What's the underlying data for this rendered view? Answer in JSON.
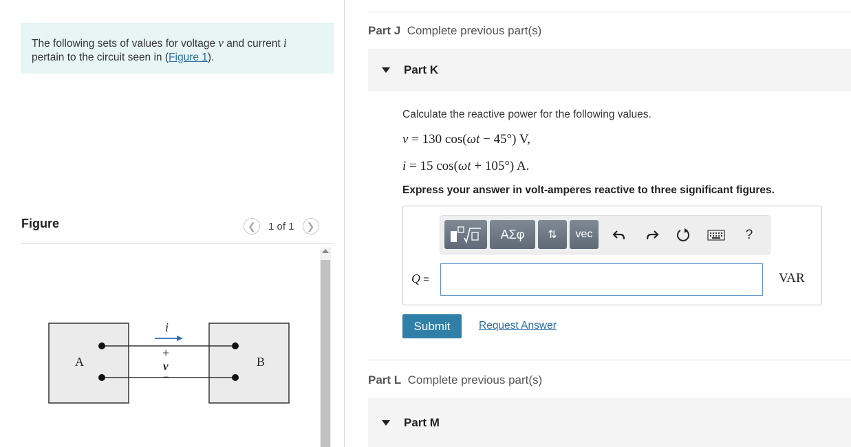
{
  "intro": {
    "text_before_v": "The following sets of values for voltage ",
    "var_v": "v",
    "text_and_current": " and current ",
    "var_i": "i",
    "text_pertain": "pertain to the circuit seen in (",
    "figure_link": "Figure 1",
    "text_close": ")."
  },
  "figure": {
    "title": "Figure",
    "pager": "1 of 1",
    "prev_icon": "chevron-left-icon",
    "next_icon": "chevron-right-icon",
    "labels": {
      "box_a": "A",
      "box_b": "B",
      "current": "i",
      "voltage": "v",
      "plus": "+",
      "minus": "−"
    }
  },
  "parts": {
    "part_j": {
      "label": "Part J",
      "status": "Complete previous part(s)"
    },
    "part_k": {
      "label": "Part K"
    },
    "part_l": {
      "label": "Part L",
      "status": "Complete previous part(s)"
    },
    "part_m": {
      "label": "Part M"
    }
  },
  "question": {
    "prompt": "Calculate the reactive power for the following values.",
    "eq_v": {
      "lhs": "v",
      "rhs": " = 130 cos(",
      "arg_w": "ω",
      "arg_t": "t",
      "arg_rest": " − 45°) V,"
    },
    "eq_i": {
      "lhs": "i",
      "rhs": " = 15 cos(",
      "arg_w": "ω",
      "arg_t": "t",
      "arg_rest": " + 105°) A."
    },
    "instruction": "Express your answer in volt-amperes reactive to three significant figures."
  },
  "answer": {
    "toolbar": {
      "templates_icon": "math-templates-icon",
      "greek": "ΑΣφ",
      "sort_icon": "up-down-arrows-icon",
      "vec": "vec",
      "undo_icon": "undo-icon",
      "redo_icon": "redo-icon",
      "reset_icon": "reset-icon",
      "keyboard_icon": "keyboard-icon",
      "help": "?"
    },
    "var_label": "Q",
    "equals": " =",
    "value": "",
    "unit": "VAR"
  },
  "actions": {
    "submit": "Submit",
    "request": "Request Answer"
  }
}
